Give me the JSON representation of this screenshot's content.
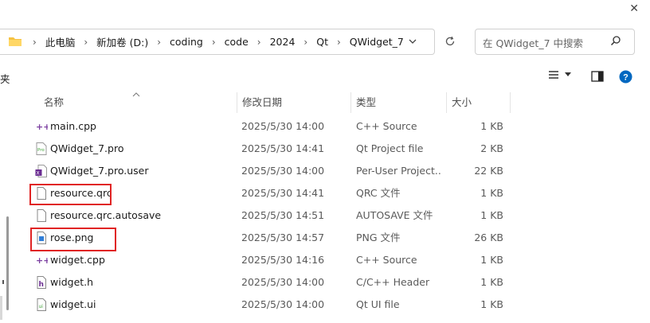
{
  "address": {
    "crumbs": [
      "此电脑",
      "新加卷 (D:)",
      "coding",
      "code",
      "2024",
      "Qt",
      "QWidget_7"
    ]
  },
  "search": {
    "placeholder": "在 QWidget_7 中搜索"
  },
  "toolbar": {
    "left_text": "夹"
  },
  "columns": {
    "name": "名称",
    "date": "修改日期",
    "type": "类型",
    "size": "大小"
  },
  "files": [
    {
      "name": "main.cpp",
      "date": "2025/5/30 14:00",
      "type": "C++ Source",
      "size": "1 KB",
      "icon": "cpp-file-icon"
    },
    {
      "name": "QWidget_7.pro",
      "date": "2025/5/30 14:41",
      "type": "Qt Project file",
      "size": "2 KB",
      "icon": "pro-file-icon"
    },
    {
      "name": "QWidget_7.pro.user",
      "date": "2025/5/30 14:00",
      "type": "Per-User Project...",
      "size": "22 KB",
      "icon": "pro-user-file-icon"
    },
    {
      "name": "resource.qrc",
      "date": "2025/5/30 14:41",
      "type": "QRC 文件",
      "size": "1 KB",
      "icon": "blank-file-icon"
    },
    {
      "name": "resource.qrc.autosave",
      "date": "2025/5/30 14:51",
      "type": "AUTOSAVE 文件",
      "size": "1 KB",
      "icon": "blank-file-icon"
    },
    {
      "name": "rose.png",
      "date": "2025/5/30 14:57",
      "type": "PNG 文件",
      "size": "26 KB",
      "icon": "image-file-icon"
    },
    {
      "name": "widget.cpp",
      "date": "2025/5/30 14:16",
      "type": "C++ Source",
      "size": "1 KB",
      "icon": "cpp-file-icon"
    },
    {
      "name": "widget.h",
      "date": "2025/5/30 14:00",
      "type": "C/C++ Header",
      "size": "1 KB",
      "icon": "header-file-icon"
    },
    {
      "name": "widget.ui",
      "date": "2025/5/30 14:00",
      "type": "Qt UI file",
      "size": "1 KB",
      "icon": "ui-file-icon"
    }
  ],
  "colors": {
    "highlight": "#e02424",
    "folder": "#f5c242",
    "accent": "#0067c0"
  }
}
